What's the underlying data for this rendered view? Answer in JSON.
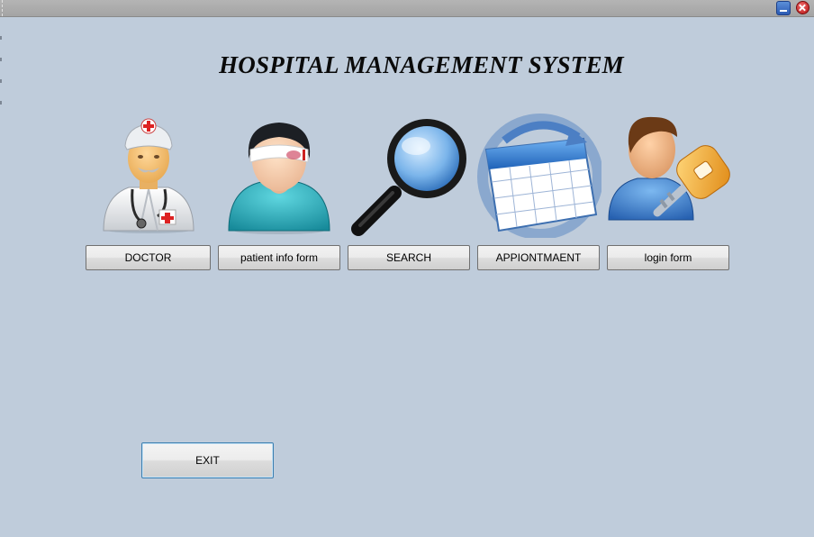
{
  "window": {
    "minimize_icon": "minimize-icon",
    "close_icon": "close-icon"
  },
  "header": {
    "title": "HOSPITAL MANAGEMENT SYSTEM"
  },
  "modules": [
    {
      "label": "DOCTOR",
      "icon": "doctor-icon"
    },
    {
      "label": "patient info form",
      "icon": "patient-icon"
    },
    {
      "label": "SEARCH",
      "icon": "magnifier-icon"
    },
    {
      "label": "APPIONTMAENT",
      "icon": "calendar-icon"
    },
    {
      "label": "login form",
      "icon": "user-key-icon"
    }
  ],
  "exit": {
    "label": "EXIT"
  },
  "colors": {
    "background": "#bfccdb",
    "titlebar": "#a8a8a8",
    "button_border": "#707070",
    "exit_border": "#3c7fb1"
  }
}
